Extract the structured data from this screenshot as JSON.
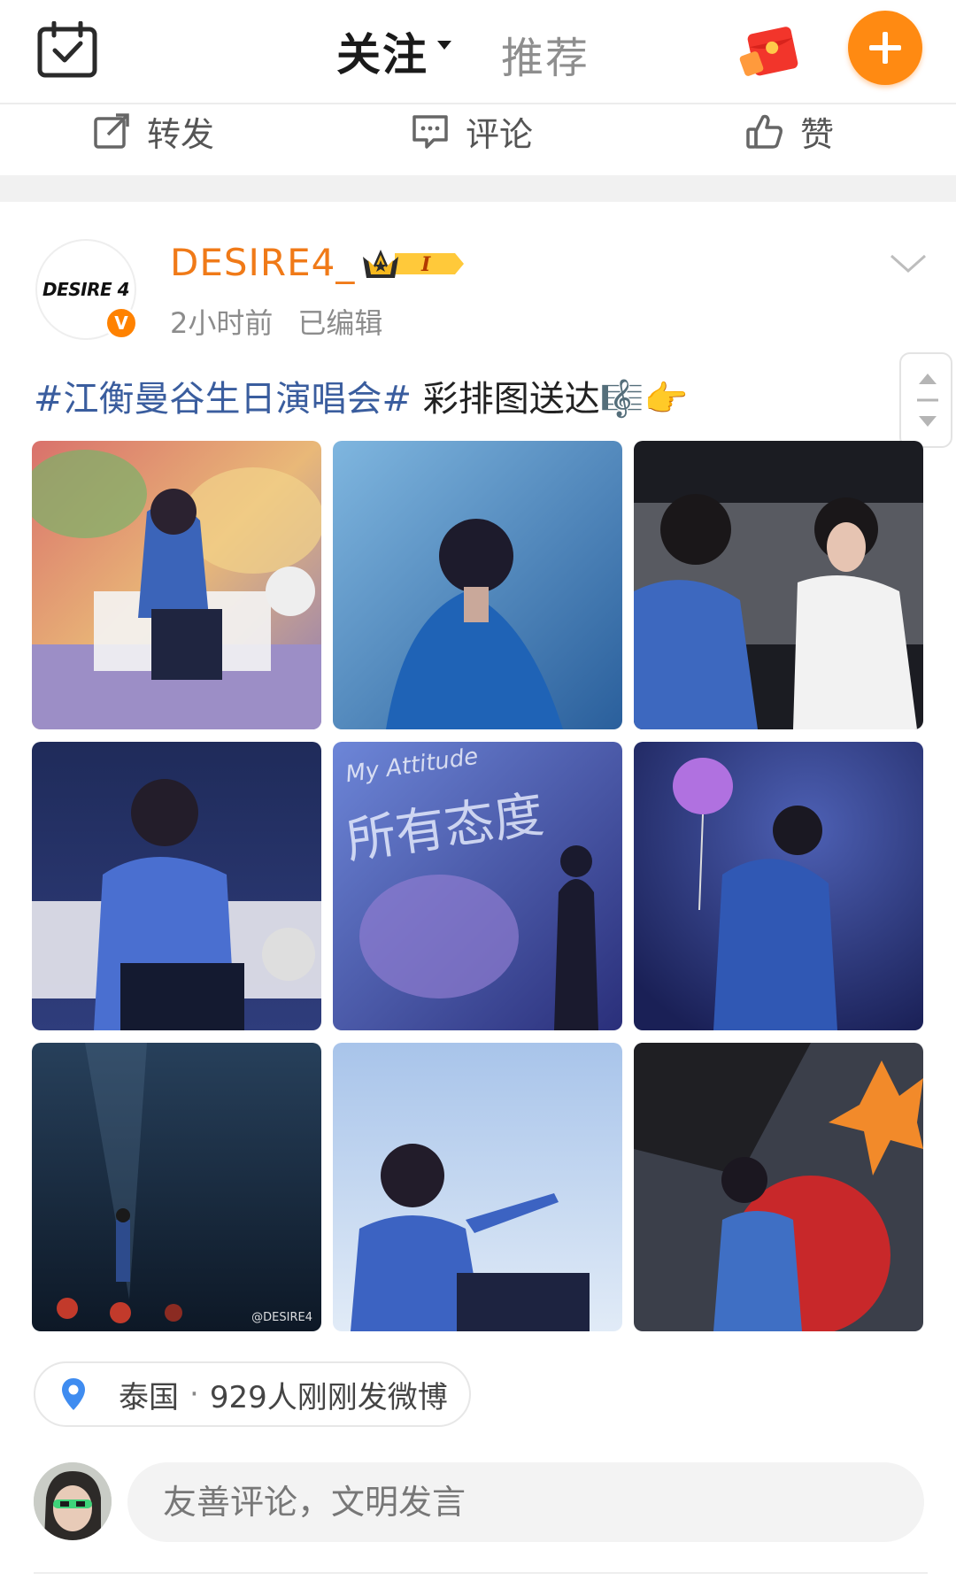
{
  "header": {
    "tab_follow": "关注",
    "tab_recommend": "推荐",
    "accent_color": "#ff8a12",
    "underline_color": "#ffb400",
    "icons": [
      "calendar-check-icon",
      "caret-down-icon",
      "red-packet-icon",
      "plus-icon"
    ]
  },
  "actions": {
    "repost": "转发",
    "comment": "评论",
    "like": "赞"
  },
  "post": {
    "avatar_text": "DESIRE 4",
    "username": "DESIRE4_",
    "vip_level": "I",
    "time": "2小时前",
    "edited": "已编辑",
    "hashtag": "#江衡曼谷生日演唱会#",
    "text": " 彩排图送达🎼👉",
    "images": [
      {
        "name": "rehearsal-photo-1"
      },
      {
        "name": "rehearsal-photo-2"
      },
      {
        "name": "rehearsal-photo-3"
      },
      {
        "name": "rehearsal-photo-4"
      },
      {
        "name": "rehearsal-photo-5",
        "overlay_small": "My Attitude",
        "overlay_big": "所有态度"
      },
      {
        "name": "rehearsal-photo-6"
      },
      {
        "name": "rehearsal-photo-7",
        "watermark": "@DESIRE4"
      },
      {
        "name": "rehearsal-photo-8"
      },
      {
        "name": "rehearsal-photo-9"
      }
    ]
  },
  "location": {
    "place": "泰国",
    "separator": "·",
    "detail": "929人刚刚发微博"
  },
  "comment_box": {
    "placeholder": "友善评论，文明发言"
  }
}
